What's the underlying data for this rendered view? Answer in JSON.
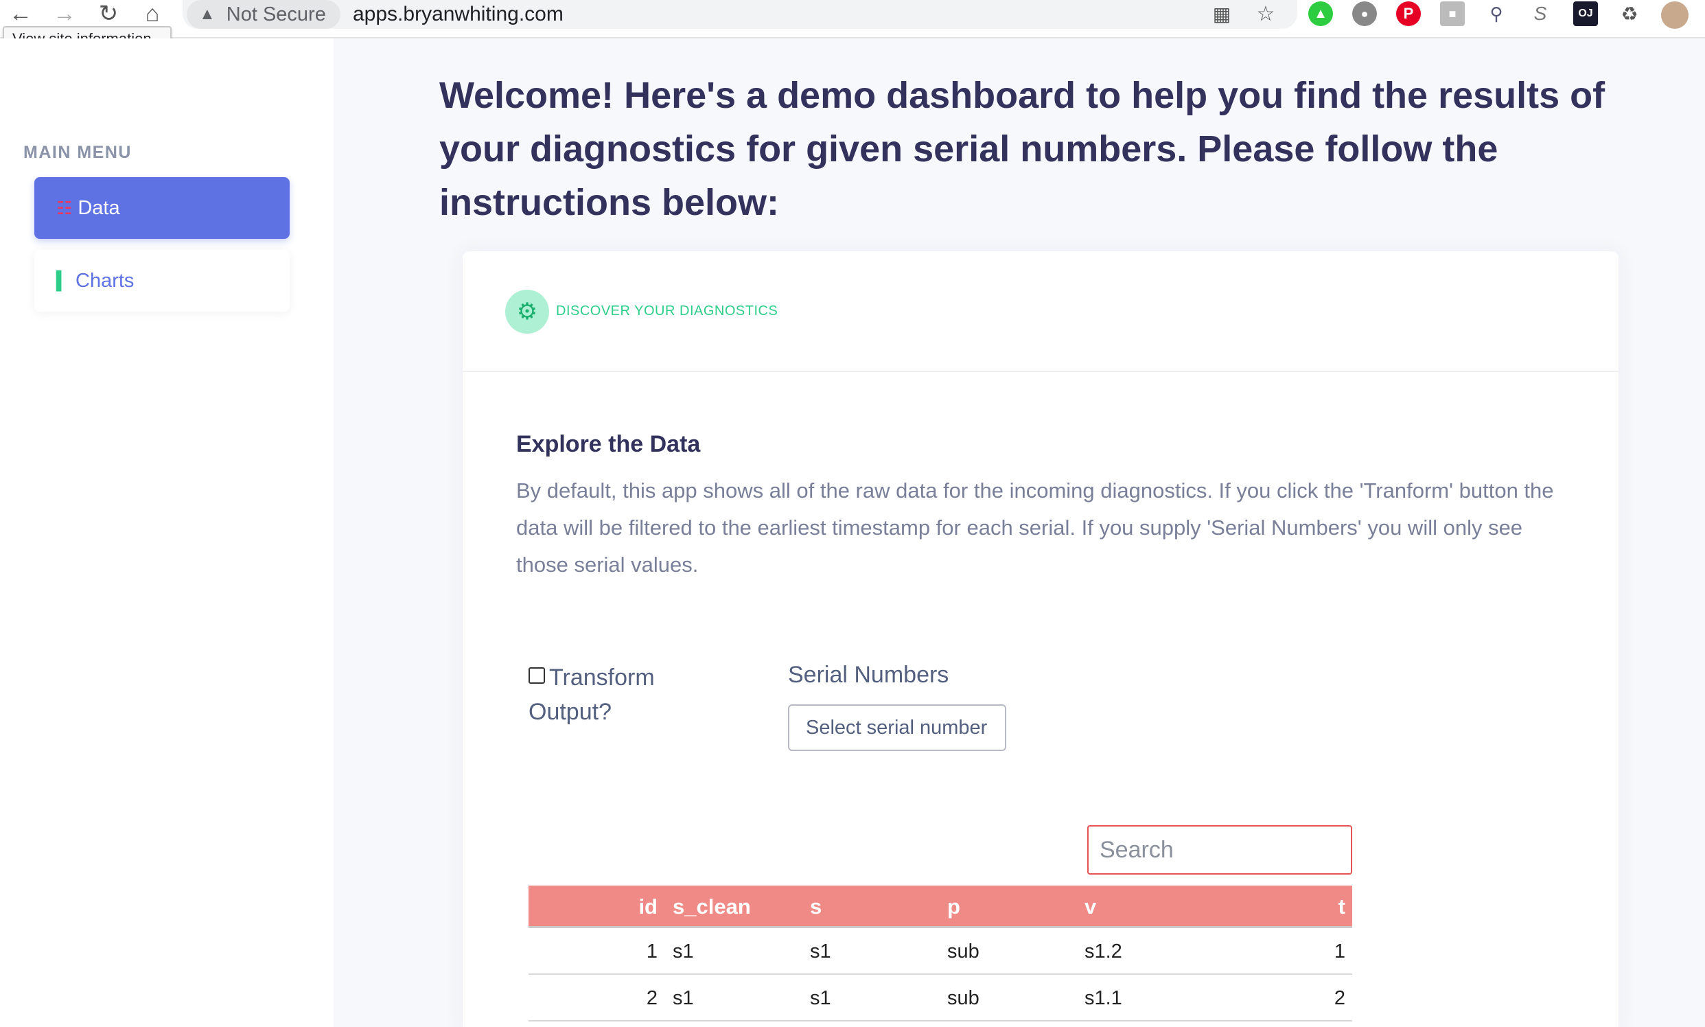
{
  "browser": {
    "security_label": "Not Secure",
    "url": "apps.bryanwhiting.com",
    "tooltip": "View site information",
    "extensions": [
      "grid-icon",
      "star-icon",
      "green-extension-icon",
      "grey-circle-icon",
      "pinterest-icon",
      "grey-square-icon",
      "magnifier-icon",
      "s-icon",
      "oj-icon",
      "puzzle-icon",
      "avatar"
    ]
  },
  "sidebar": {
    "menu_title": "MAIN MENU",
    "items": [
      {
        "label": "Data",
        "icon": "table-icon",
        "active": true
      },
      {
        "label": "Charts",
        "icon": "bar-chart-icon",
        "active": false
      }
    ]
  },
  "main": {
    "headline": "Welcome! Here's a demo dashboard to help you find the results of your diagnostics for given serial numbers. Please follow the instructions below:",
    "card": {
      "header_title": "DISCOVER YOUR DIAGNOSTICS",
      "section_title": "Explore the Data",
      "description": "By default, this app shows all of the raw data for the incoming diagnostics. If you click the 'Tranform' button the data will be filtered to the earliest timestamp for each serial. If you supply 'Serial Numbers' you will only see those serial values.",
      "transform_label": "Transform Output?",
      "transform_checked": false,
      "serial_label": "Serial Numbers",
      "serial_placeholder": "Select serial number",
      "search_placeholder": "Search",
      "table": {
        "columns": [
          "id",
          "s_clean",
          "s",
          "p",
          "v",
          "t"
        ],
        "rows": [
          [
            "1",
            "s1",
            "s1",
            "sub",
            "s1.2",
            "1"
          ],
          [
            "2",
            "s1",
            "s1",
            "sub",
            "s1.1",
            "2"
          ]
        ]
      }
    }
  },
  "colors": {
    "accent": "#5e72e4",
    "success": "#2dce89",
    "table_header": "#ef8a86",
    "search_border": "#e55353"
  }
}
